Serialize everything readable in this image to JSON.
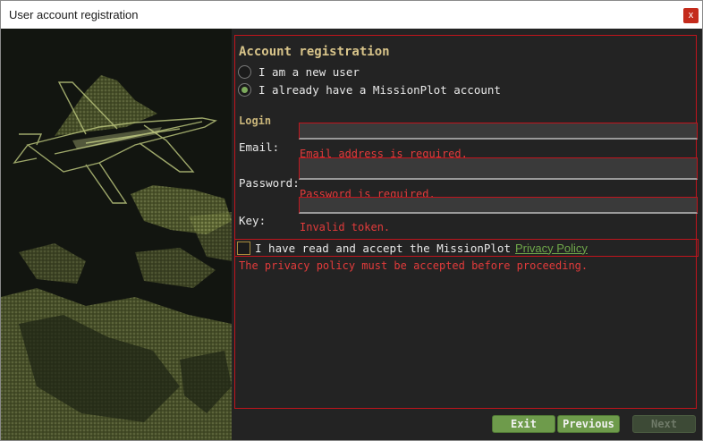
{
  "window": {
    "title": "User account registration",
    "close_label": "x"
  },
  "form": {
    "heading": "Account registration",
    "account_type": {
      "options": [
        {
          "label": "I am a new user",
          "checked": false
        },
        {
          "label": "I already have a MissionPlot account",
          "checked": true
        }
      ]
    },
    "login_section_label": "Login",
    "fields": {
      "email": {
        "label": "Email:",
        "value": "",
        "error": "Email address is required."
      },
      "password": {
        "label": "Password:",
        "value": "",
        "error": "Password is required."
      },
      "key": {
        "label": "Key:",
        "value": "",
        "error": "Invalid token."
      }
    },
    "privacy": {
      "text": "I have read and accept the MissionPlot",
      "link_text": "Privacy Policy",
      "checked": false,
      "error": "The privacy policy must be accepted before proceeding."
    }
  },
  "buttons": {
    "exit": "Exit",
    "previous": "Previous",
    "next": "Next"
  },
  "colors": {
    "accent_green": "#6e9b4b",
    "error_red": "#e23b3b",
    "border_red": "#c0141c",
    "heading_gold": "#d8c48a"
  }
}
